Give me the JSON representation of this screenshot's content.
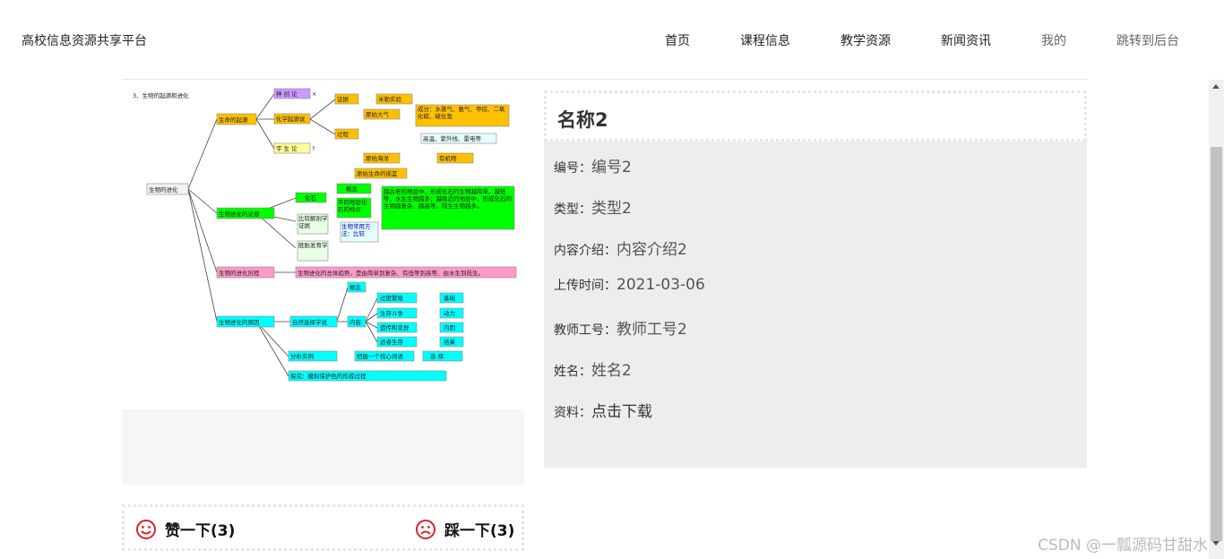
{
  "header": {
    "brand": "高校信息资源共享平台",
    "nav": [
      "首页",
      "课程信息",
      "教学资源",
      "新闻资讯",
      "我的",
      "跳转到后台"
    ]
  },
  "resource": {
    "title": "名称2",
    "fields": [
      {
        "label": "编号：",
        "value": "编号2"
      },
      {
        "label": "类型：",
        "value": "类型2"
      },
      {
        "label": "内容介绍：",
        "value": "内容介绍2"
      },
      {
        "label": "上传时间：",
        "value": "2021-03-06"
      },
      {
        "label": "教师工号：",
        "value": "教师工号2"
      },
      {
        "label": "姓名：",
        "value": "姓名2"
      },
      {
        "label": "资料：",
        "value": "点击下载"
      }
    ]
  },
  "votes": {
    "like_label": "赞一下(3)",
    "dislike_label": "踩一下(3)",
    "icon_color": "#d9232b"
  },
  "image": {
    "heading": "3、生物的起源和进化",
    "root": "生物的进化",
    "branches": [
      "生命的起源",
      "生物进化的证据",
      "生物的进化历程",
      "生物进化的原因"
    ],
    "origin_nodes": [
      "神 创 论",
      "化学起源说",
      "宇 生 论",
      "证据",
      "米勒实验",
      "过程",
      "原始大气",
      "成分：水蒸气、氨气、甲烷、二氧化碳、硫化氢",
      "高温、紫外线、雷电等",
      "原始海洋",
      "有机物",
      "原始生命的摇篮"
    ],
    "evidence_nodes": [
      "化石",
      "概念",
      "不同地层化石的特点",
      "比较解剖学证据",
      "胚胎发育学",
      "生物常用方法：比较",
      "越古老的地层中，形成化石的生物越简单、越低等，水生生物越多；越晚近的地层中，形成化石的生物越复杂、越高等，陆生生物越多。"
    ],
    "history_node": "生物进化的总体趋势，是由简单到复杂、有低等到高等、由水生到陆生。",
    "cause_nodes": [
      "自然选择学说",
      "概念",
      "内容",
      "过度繁殖",
      "生存斗争",
      "遗传和变异",
      "适者生存",
      "基础",
      "动力",
      "内因",
      "结果",
      "分析实例",
      "把握一个核心词语",
      "选 择",
      "探究：模拟保护色的形成过程"
    ]
  },
  "watermark": "CSDN @一瓢源码甘甜水"
}
